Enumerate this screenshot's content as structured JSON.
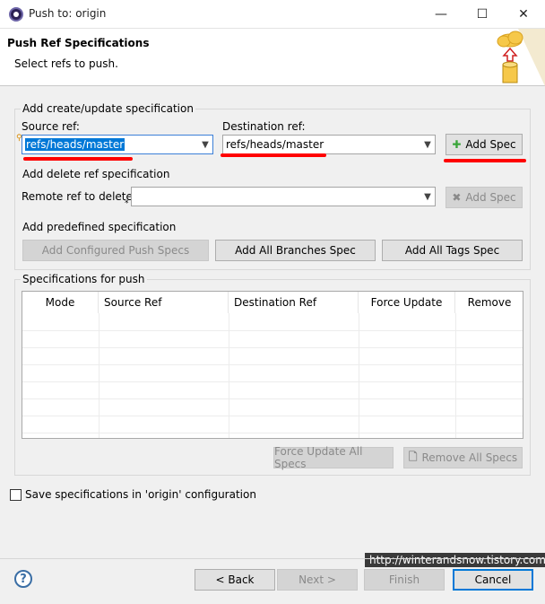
{
  "window": {
    "title": "Push to: origin",
    "minimize": "—",
    "maximize": "☐",
    "close": "✕"
  },
  "header": {
    "title": "Push Ref Specifications",
    "subtitle": "Select refs to push."
  },
  "create_group": {
    "label": "Add create/update specification",
    "source_label": "Source ref:",
    "source_value": "refs/heads/master",
    "dest_label": "Destination ref:",
    "dest_value": "refs/heads/master",
    "add_spec": "Add Spec"
  },
  "delete_group": {
    "label": "Add delete ref specification",
    "remote_label": "Remote ref to delete:",
    "remote_value": "",
    "add_spec": "Add Spec"
  },
  "predefined_group": {
    "label": "Add predefined specification",
    "configured": "Add Configured Push Specs",
    "all_branches": "Add All Branches Spec",
    "all_tags": "Add All Tags Spec"
  },
  "specs_group": {
    "label": "Specifications for push",
    "columns": [
      "Mode",
      "Source Ref",
      "Destination Ref",
      "Force Update",
      "Remove"
    ],
    "force_update_all": "Force Update All Specs",
    "remove_all": "Remove All Specs"
  },
  "save_config": {
    "label": "Save specifications in 'origin' configuration",
    "checked": false
  },
  "watermark": "http://winterandsnow.tistory.com",
  "footer": {
    "help": "?",
    "back": "< Back",
    "next": "Next >",
    "finish": "Finish",
    "cancel": "Cancel"
  },
  "colors": {
    "annotation": "#ff0000",
    "selection": "#0078d7"
  }
}
